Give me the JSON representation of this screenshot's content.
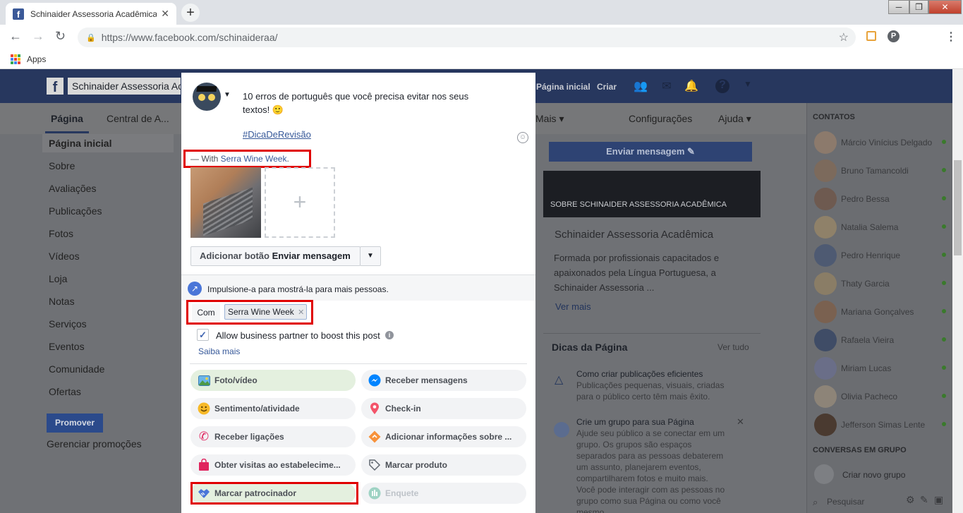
{
  "browser": {
    "tab_title": "Schinaider Assessoria Acadêmica",
    "tab_close": "✕",
    "new_tab": "+",
    "url_host": "https://www.facebook.com/",
    "url_path": "schinaideraa/",
    "bookmark_apps": "Apps",
    "window_buttons": [
      "─",
      "❐",
      "✕"
    ]
  },
  "fb_header": {
    "search_value": "Schinaider Assessoria Acadêmica",
    "nav": [
      "Página inicial",
      "Criar"
    ]
  },
  "page_nav": {
    "tabs": [
      "Página",
      "Central de A...",
      "Mais ▾",
      "Configurações",
      "Ajuda ▾"
    ]
  },
  "left_nav": {
    "items": [
      "Página inicial",
      "Sobre",
      "Avaliações",
      "Publicações",
      "Fotos",
      "Vídeos",
      "Loja",
      "Notas",
      "Serviços",
      "Eventos",
      "Comunidade",
      "Ofertas"
    ],
    "promote_button": "Promover",
    "manage_promotions": "Gerenciar promoções"
  },
  "right_col": {
    "send_message_button": "Enviar mensagem ✎",
    "about_header": "SOBRE SCHINAIDER ASSESSORIA ACADÊMICA",
    "about_title": "Schinaider Assessoria Acadêmica",
    "about_text": [
      "Formada por profissionais capacitados e",
      "apaixonados pela Língua Portuguesa, a",
      "Schinaider Assessoria ..."
    ],
    "see_more": "Ver mais",
    "tips_title": "Dicas da Página",
    "tips_see_all": "Ver tudo",
    "tip1_title": "Como criar publicações eficientes",
    "tip1_text": [
      "Publicações pequenas, visuais, criadas",
      "para o público certo têm mais êxito."
    ],
    "tip2_title": "Crie um grupo para sua Página",
    "tip2_text": [
      "Ajude seu público a se conectar em um",
      "grupo. Os grupos são espaços",
      "separados para as pessoas debaterem",
      "um assunto, planejarem eventos,",
      "compartilharem fotos e muito mais.",
      "Você pode interagir com as pessoas no",
      "grupo como sua Página ou como você",
      "mesmo."
    ]
  },
  "chat": {
    "contacts_header": "CONTATOS",
    "contacts": [
      "Márcio Vinícius Delgado",
      "Bruno Tamancoldi",
      "Pedro Bessa",
      "Natalia Salema",
      "Pedro Henrique",
      "Thaty Garcia",
      "Mariana Gonçalves",
      "Rafaela Vieira",
      "Miriam Lucas",
      "Olivia Pacheco",
      "Jefferson Simas Lente"
    ],
    "group_header": "CONVERSAS EM GRUPO",
    "new_group": "Criar novo grupo",
    "search_placeholder": "Pesquisar"
  },
  "composer": {
    "post_line1": "10 erros de português que você precisa evitar nos seus",
    "post_line2": "textos! 🙂",
    "hashtag": "#DicaDeRevisão",
    "with_prefix": "— With ",
    "with_partner": "Serra Wine Week",
    "with_suffix": ".",
    "add_button_prefix": "Adicionar botão ",
    "add_button_action": "Enviar mensagem",
    "boost_text": "Impulsione-a para mostrá-la para mais pessoas.",
    "com_label": "Com",
    "partner_tag": "Serra Wine Week",
    "allow_partner": "Allow business partner to boost this post",
    "learn_more": "Saiba mais",
    "actions": [
      {
        "label": "Foto/vídeo",
        "icon": "photo-icon"
      },
      {
        "label": "Receber mensagens",
        "icon": "messenger-icon"
      },
      {
        "label": "Sentimento/atividade",
        "icon": "smiley-icon"
      },
      {
        "label": "Check-in",
        "icon": "location-pin-icon"
      },
      {
        "label": "Receber ligações",
        "icon": "phone-icon"
      },
      {
        "label": "Adicionar informações sobre ...",
        "icon": "info-diamond-icon"
      },
      {
        "label": "Obter visitas ao estabelecime...",
        "icon": "shopping-bag-icon"
      },
      {
        "label": "Marcar produto",
        "icon": "tag-icon"
      },
      {
        "label": "Marcar patrocinador",
        "icon": "handshake-icon"
      },
      {
        "label": "Enquete",
        "icon": "poll-icon"
      }
    ]
  },
  "colors": {
    "fb_blue": "#3b5998",
    "link": "#365899",
    "highlight_red": "#e00000",
    "overlay_gray": "#6f7175"
  }
}
